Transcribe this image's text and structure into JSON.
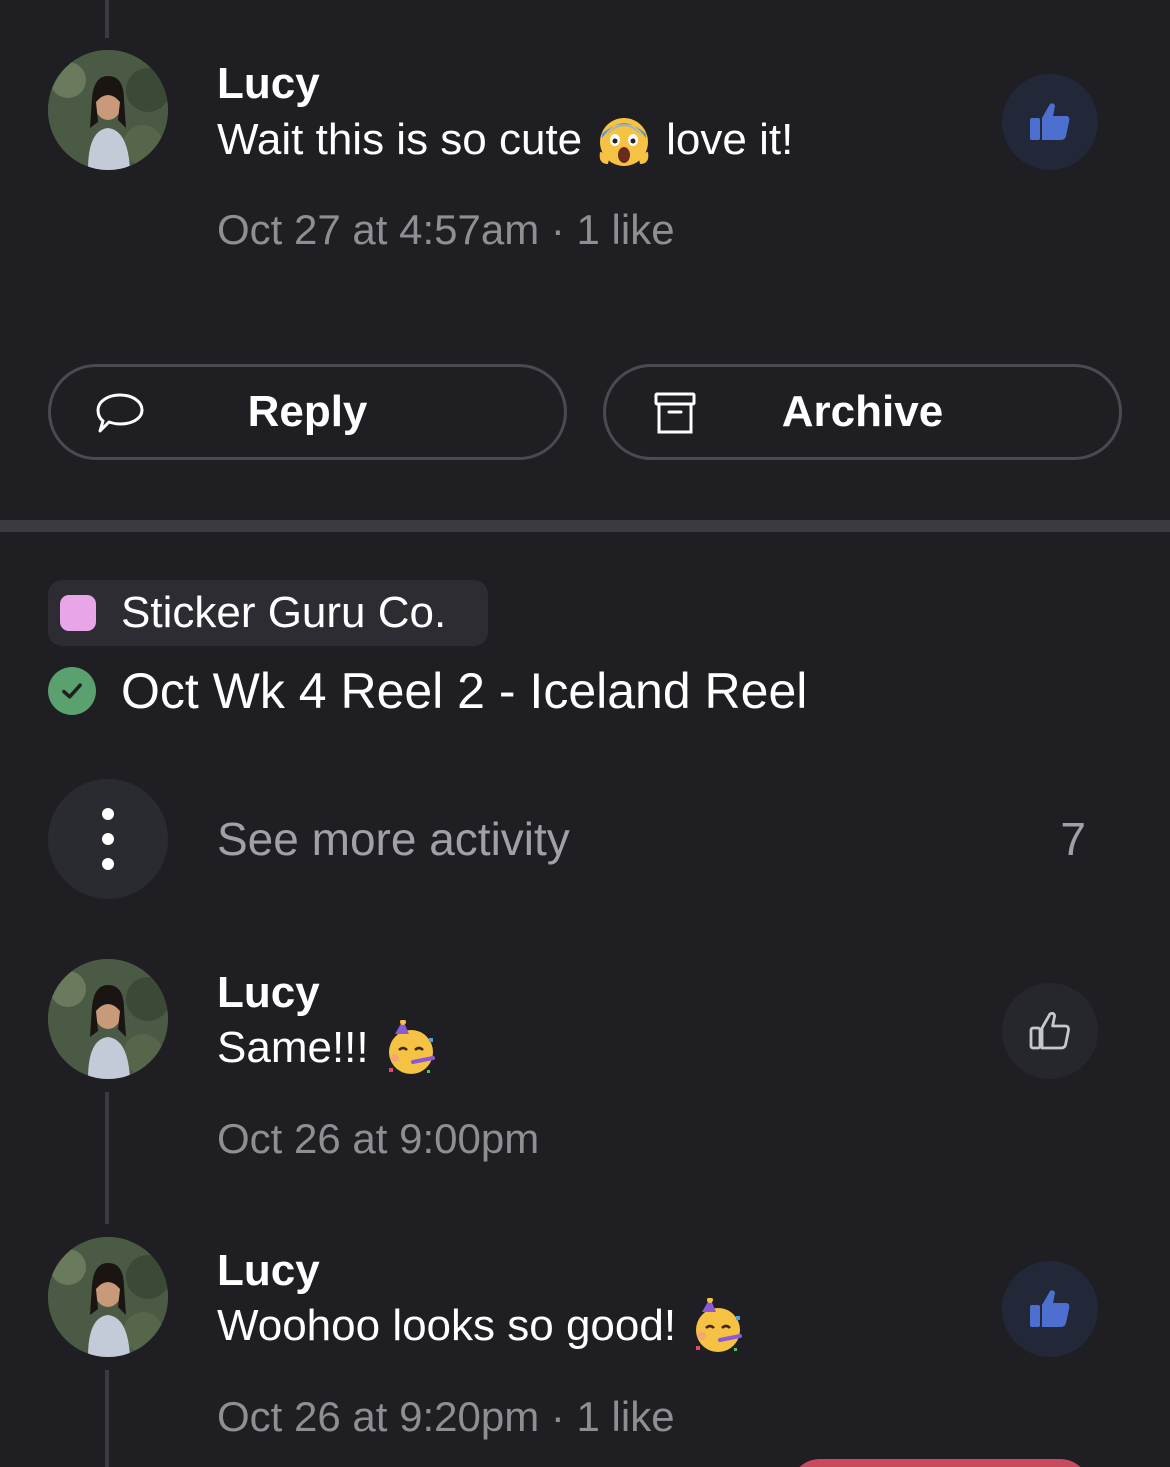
{
  "comments_top": [
    {
      "name": "Lucy",
      "text_before": "Wait this is so cute",
      "emoji": "face-screaming-in-fear",
      "text_after": "love it!",
      "meta": "Oct 27 at 4:57am · 1 like",
      "liked": true
    }
  ],
  "actions": {
    "reply_label": "Reply",
    "archive_label": "Archive"
  },
  "task": {
    "project_name": "Sticker Guru Co.",
    "project_color": "#e8a5e8",
    "title": "Oct Wk 4 Reel 2 - Iceland Reel",
    "status_color": "#5aa16f"
  },
  "activity": {
    "see_more_label": "See more activity",
    "count": "7"
  },
  "comments": [
    {
      "name": "Lucy",
      "text": "Same!!!",
      "emoji": "partying-face",
      "meta": "Oct 26 at 9:00pm",
      "liked": false
    },
    {
      "name": "Lucy",
      "text": "Woohoo looks so good!",
      "emoji": "partying-face",
      "meta": "Oct 26 at 9:20pm · 1 like",
      "liked": true
    }
  ],
  "colors": {
    "background": "#1e1e23",
    "like_active": "#4d6fcf",
    "muted_text": "#8e8e93"
  }
}
